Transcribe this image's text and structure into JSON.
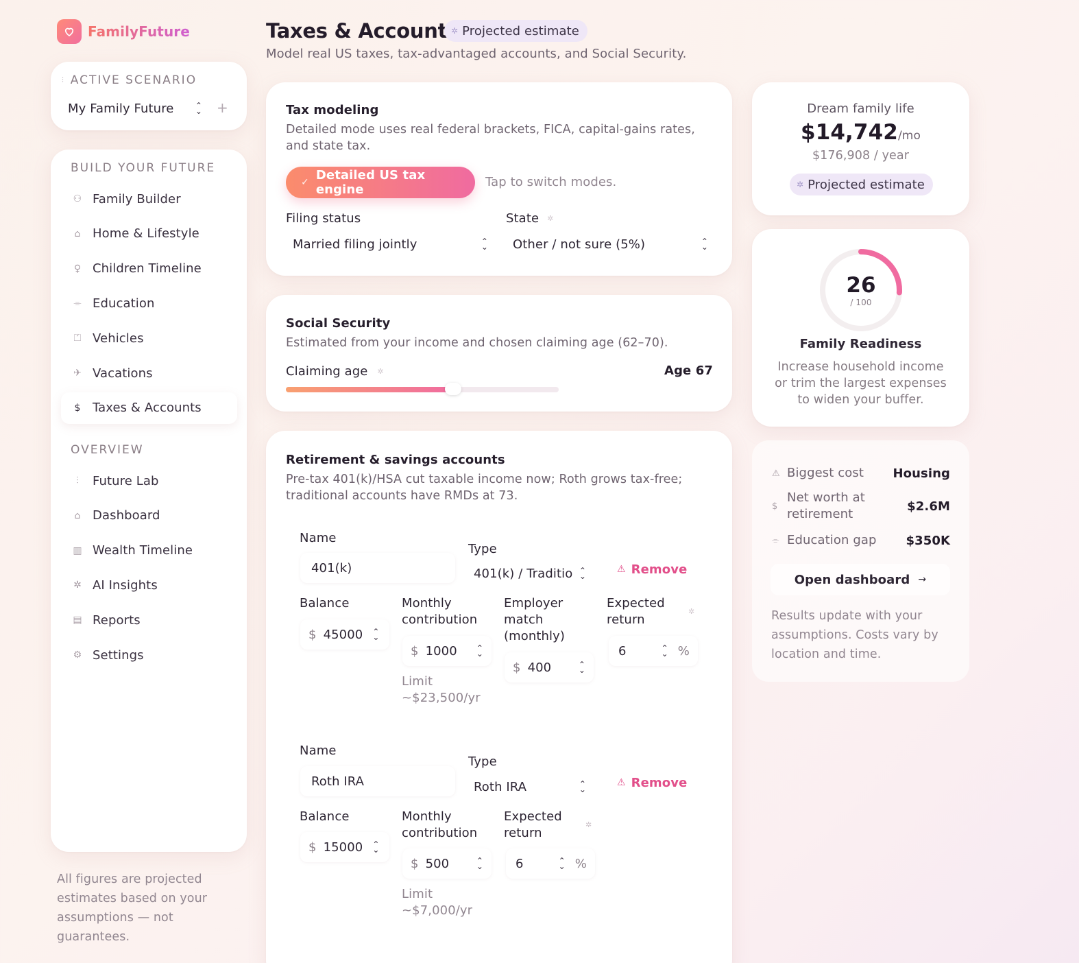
{
  "brand": {
    "name": "FamilyFuture"
  },
  "sidebar": {
    "active_scenario_label": "ACTIVE SCENARIO",
    "scenario_value": "My Family Future",
    "build_label": "BUILD YOUR FUTURE",
    "build_items": [
      {
        "label": "Family Builder",
        "icon": "people-icon"
      },
      {
        "label": "Home & Lifestyle",
        "icon": "home-icon"
      },
      {
        "label": "Children Timeline",
        "icon": "child-icon"
      },
      {
        "label": "Education",
        "icon": "graduation-cap-icon"
      },
      {
        "label": "Vehicles",
        "icon": "car-icon"
      },
      {
        "label": "Vacations",
        "icon": "plane-icon"
      },
      {
        "label": "Taxes & Accounts",
        "icon": "dollar-icon",
        "active": true
      }
    ],
    "overview_label": "OVERVIEW",
    "overview_items": [
      {
        "label": "Future Lab",
        "icon": "sliders-icon"
      },
      {
        "label": "Dashboard",
        "icon": "house-icon"
      },
      {
        "label": "Wealth Timeline",
        "icon": "bar-chart-icon"
      },
      {
        "label": "AI Insights",
        "icon": "sparkle-icon"
      },
      {
        "label": "Reports",
        "icon": "document-icon"
      },
      {
        "label": "Settings",
        "icon": "gear-icon"
      }
    ],
    "footer_note": "All figures are projected estimates based on your assumptions — not guarantees."
  },
  "header": {
    "title": "Taxes & Accounts",
    "badge": "Projected estimate",
    "subtitle": "Model real US taxes, tax-advantaged accounts, and Social Security."
  },
  "tax": {
    "title": "Tax modeling",
    "description": "Detailed mode uses real federal brackets, FICA, capital-gains rates, and state tax.",
    "mode_button": "Detailed US tax engine",
    "mode_hint": "Tap to switch modes.",
    "filing_label": "Filing status",
    "filing_value": "Married filing jointly",
    "state_label": "State",
    "state_value": "Other / not sure (5%)"
  },
  "social_security": {
    "title": "Social Security",
    "description": "Estimated from your income and chosen claiming age (62–70).",
    "claiming_label": "Claiming age",
    "claiming_value": "Age 67",
    "claiming_age": 67,
    "age_min": 62,
    "age_max": 70
  },
  "retirement": {
    "title": "Retirement & savings accounts",
    "description": "Pre-tax 401(k)/HSA cut taxable income now; Roth grows tax-free; traditional accounts have RMDs at 73.",
    "name_label": "Name",
    "type_label": "Type",
    "balance_label": "Balance",
    "monthly_label": "Monthly contribution",
    "match_label": "Employer match (monthly)",
    "return_label": "Expected return",
    "remove_label": "Remove",
    "currency": "$",
    "percent": "%",
    "accounts": [
      {
        "name": "401(k)",
        "type": "401(k) / Traditio",
        "balance": "45000",
        "monthly": "1000",
        "match": "400",
        "return": "6",
        "limit": "Limit ~$23,500/yr"
      },
      {
        "name": "Roth IRA",
        "type": "Roth IRA",
        "balance": "15000",
        "monthly": "500",
        "return": "6",
        "limit": "Limit ~$7,000/yr"
      }
    ]
  },
  "dream": {
    "label": "Dream family life",
    "amount": "$14,742",
    "per": "/mo",
    "yearly": "$176,908 / year",
    "badge": "Projected estimate"
  },
  "readiness": {
    "score": "26",
    "out_of": "/ 100",
    "score_value": 26,
    "label": "Family Readiness",
    "advice": "Increase household income or trim the largest expenses to widen your buffer."
  },
  "stats": {
    "rows": [
      {
        "label": "Biggest cost",
        "value": "Housing",
        "icon": "warning-icon"
      },
      {
        "label": "Net worth at retirement",
        "value": "$2.6M",
        "icon": "dollar-icon"
      },
      {
        "label": "Education gap",
        "value": "$350K",
        "icon": "graduation-cap-icon"
      }
    ],
    "open_dashboard": "Open dashboard",
    "note": "Results update with your assumptions. Costs vary by location and time."
  },
  "colors": {
    "accent_pink": "#f06ba0",
    "accent_orange": "#fb8c6c",
    "remove": "#e24f8a"
  }
}
